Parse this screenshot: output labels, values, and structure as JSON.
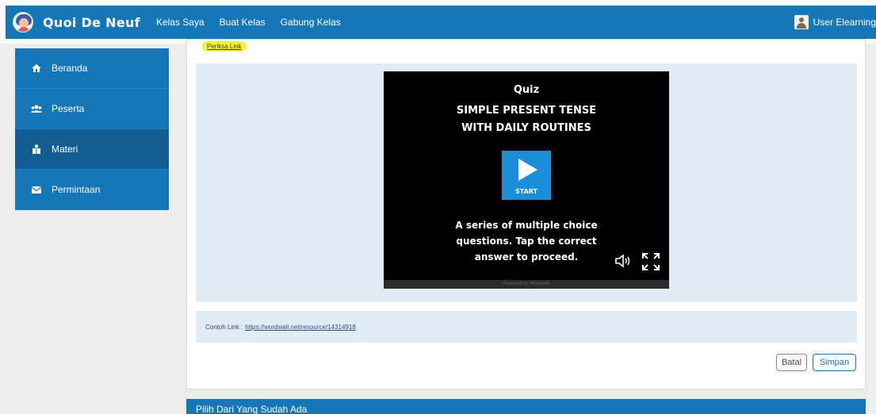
{
  "navbar": {
    "brand": "Quoi De Neuf",
    "links": [
      "Kelas Saya",
      "Buat Kelas",
      "Gabung Kelas"
    ],
    "user": "User Elearning"
  },
  "sidebar": {
    "items": [
      {
        "label": "Beranda",
        "icon": "house-icon"
      },
      {
        "label": "Peserta",
        "icon": "users-icon"
      },
      {
        "label": "Materi",
        "icon": "box-icon"
      },
      {
        "label": "Permintaan",
        "icon": "envelope-icon"
      }
    ],
    "active_index": 2
  },
  "content": {
    "check_link": "Periksa Link",
    "video": {
      "heading": "Quiz",
      "title_line1": "SIMPLE PRESENT TENSE",
      "title_line2": "WITH DAILY ROUTINES",
      "start_label": "START",
      "desc_line1": "A series of multiple choice",
      "desc_line2": "questions. Tap the correct",
      "desc_line3": "answer to proceed.",
      "footer": "Powered by Wordwall"
    },
    "example_label": "Contoh Link :",
    "example_url": "https://wordwall.net/resource/14314918",
    "cancel_button": "Batal",
    "save_button": "Simpan"
  },
  "bottom_section": {
    "title": "Pilih Dari Yang Sudah Ada"
  },
  "colors": {
    "primary": "#1677b8",
    "highlight": "#f6ef3c",
    "panel": "#e1ebf3"
  }
}
